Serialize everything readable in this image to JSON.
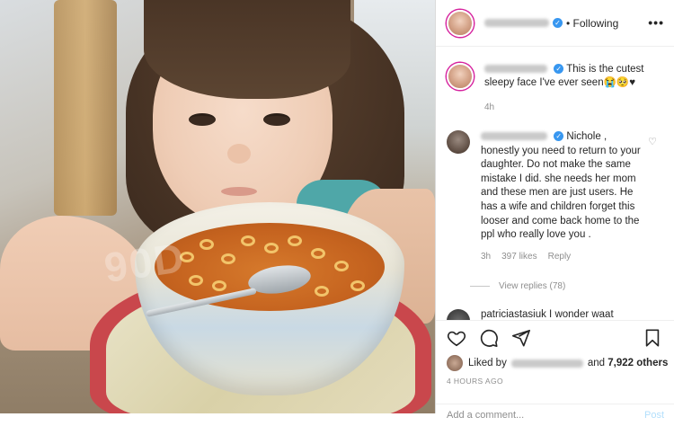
{
  "header": {
    "username": "alexpomitole",
    "follow_label": "Following",
    "more_label": "•••"
  },
  "caption": {
    "username": "alexpomitole",
    "text": "This is the cutest sleepy face I've ever seen😭🥺♥",
    "time": "4h"
  },
  "comment": {
    "username": "its_lauren_pellett",
    "text": "Nichole , honestly you need to return to your daughter. Do not make the same mistake I did. she needs her mom and these men are just users. He has a wife and children forget this looser and come back home to the ppl who really love you .",
    "time": "3h",
    "likes": "397 likes",
    "reply_label": "Reply",
    "view_replies": "View replies (78)"
  },
  "comment2": {
    "text": "patriciastasiuk I wonder waat"
  },
  "likes": {
    "prefix": "Liked by",
    "user": "jakepomitole",
    "suffix": "and",
    "count": "7,922 others"
  },
  "post_time": "4 HOURS AGO",
  "add_comment": {
    "placeholder": "Add a comment...",
    "post_label": "Post"
  },
  "photo": {
    "watermark": "90D"
  },
  "icons": {
    "heart": "heart-icon",
    "comment": "comment-icon",
    "share": "share-icon",
    "save": "bookmark-icon",
    "more": "more-icon",
    "verified": "verified-badge-icon"
  },
  "colors": {
    "verified": "#3897f0",
    "muted": "#8e8e8e",
    "text": "#262626",
    "post_button": "#b2dffc"
  }
}
